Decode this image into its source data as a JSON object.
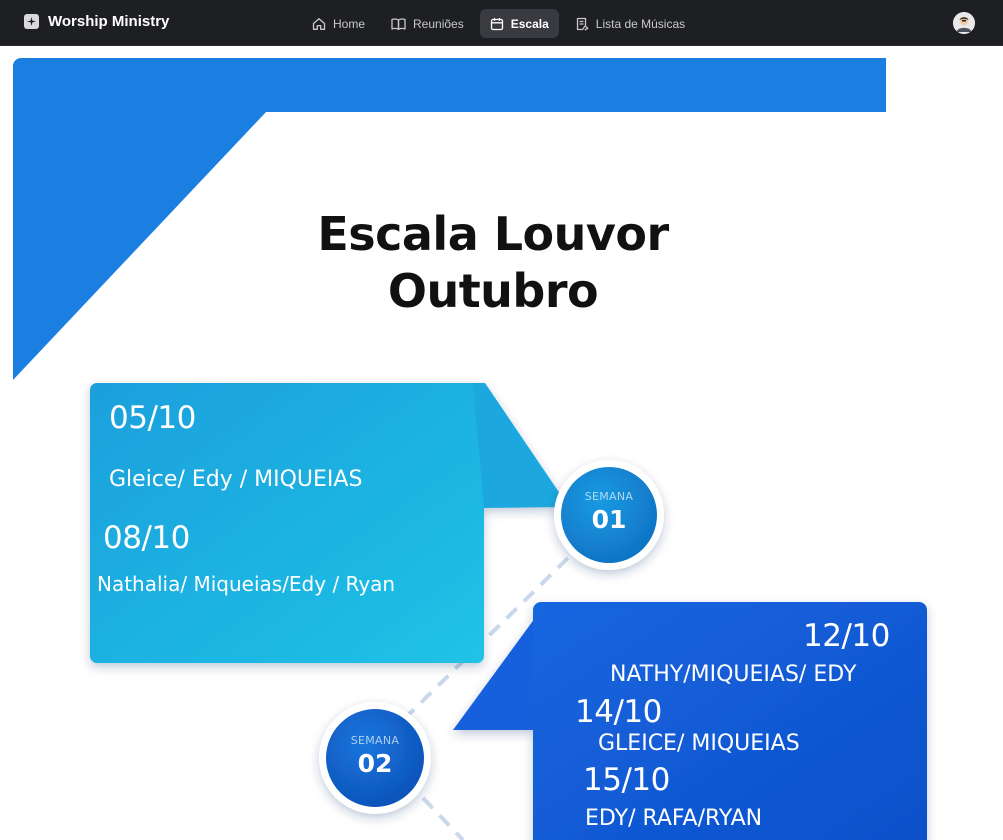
{
  "app": {
    "brand": "Worship Ministry",
    "brand_icon": "sparkle-music-icon",
    "accent_color": "#1e1f23"
  },
  "nav": {
    "items": [
      {
        "label": "Home",
        "icon": "home-icon",
        "active": false
      },
      {
        "label": "Reuniões",
        "icon": "book-open-icon",
        "active": false
      },
      {
        "label": "Escala",
        "icon": "calendar-icon",
        "active": true
      },
      {
        "label": "Lista de Músicas",
        "icon": "list-document-icon",
        "active": false
      }
    ],
    "avatar": "user-avatar"
  },
  "poster": {
    "title_line1": "Escala Louvor",
    "title_line2": "Outubro",
    "colors": {
      "banner": "#1a7fe0",
      "card_light": "#1fb3e0",
      "card_dark": "#1560de",
      "circle": "#1388d8"
    },
    "weeks": [
      {
        "label": "SEMANA",
        "number": "01",
        "entries": [
          {
            "date": "05/10",
            "names": "Gleice/ Edy / MIQUEIAS"
          },
          {
            "date": "08/10",
            "names": "Nathalia/ Miqueias/Edy / Ryan"
          }
        ]
      },
      {
        "label": "SEMANA",
        "number": "02",
        "entries": [
          {
            "date": "12/10",
            "names": "NATHY/MIQUEIAS/ EDY"
          },
          {
            "date": "14/10",
            "names": "GLEICE/ MIQUEIAS"
          },
          {
            "date": "15/10",
            "names": "EDY/ RAFA/RYAN"
          }
        ]
      }
    ]
  }
}
